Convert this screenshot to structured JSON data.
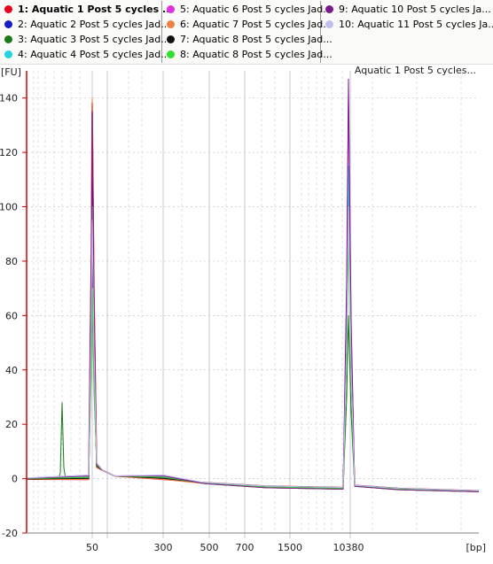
{
  "legend": {
    "items": [
      {
        "label": "1: Aquatic 1 Post 5 cycles ...",
        "color": "#e8001c",
        "selected": true
      },
      {
        "label": "2: Aquatic 2 Post 5 cycles Jad...",
        "color": "#1a1ac8"
      },
      {
        "label": "3: Aquatic 3 Post 5 cycles Jad...",
        "color": "#1a7a1a"
      },
      {
        "label": "4: Aquatic 4 Post 5 cycles Jad...",
        "color": "#22d4e0"
      },
      {
        "label": "5: Aquatic 6 Post 5 cycles Jad...",
        "color": "#e030e0"
      },
      {
        "label": "6: Aquatic 7 Post 5 cycles Jad...",
        "color": "#f08040"
      },
      {
        "label": "7: Aquatic 8 Post 5 cycles Jad...",
        "color": "#111111"
      },
      {
        "label": "8: Aquatic 8 Post 5 cycles Jad...",
        "color": "#30e030"
      },
      {
        "label": "9: Aquatic 10 Post 5 cycles Ja...",
        "color": "#7a1a8a"
      },
      {
        "label": "10: Aquatic 11 Post 5 cycles Ja...",
        "color": "#c0c0f0"
      }
    ]
  },
  "chart_data": {
    "type": "line",
    "title": "Aquatic 1 Post 5 cycles...",
    "ylabel": "[FU]",
    "xlabel": "[bp]",
    "ylim": [
      -20,
      150
    ],
    "yticks": [
      -20,
      0,
      20,
      40,
      60,
      80,
      100,
      120,
      140
    ],
    "xtick_labels": [
      "50",
      "300",
      "500",
      "700",
      "1500",
      "10380"
    ],
    "grid": true,
    "series": [
      {
        "name": "1: Aquatic 1 Post 5 cycles ...",
        "color": "#e8001c",
        "peak_lower": 138,
        "peak_upper": 104
      },
      {
        "name": "2: Aquatic 2 Post 5 cycles Jad...",
        "color": "#1a1ac8",
        "peak_lower": 110,
        "peak_upper": 100
      },
      {
        "name": "3: Aquatic 3 Post 5 cycles Jad...",
        "color": "#1a7a1a",
        "peak_lower": 100,
        "peak_upper": 60,
        "extra_peak": 28
      },
      {
        "name": "4: Aquatic 4 Post 5 cycles Jad...",
        "color": "#22d4e0",
        "peak_lower": 100,
        "peak_upper": 115
      },
      {
        "name": "5: Aquatic 6 Post 5 cycles Jad...",
        "color": "#e030e0",
        "peak_lower": 65,
        "peak_upper": 140
      },
      {
        "name": "6: Aquatic 7 Post 5 cycles Jad...",
        "color": "#f08040",
        "peak_lower": 140,
        "peak_upper": 100
      },
      {
        "name": "7: Aquatic 8 Post 5 cycles Jad...",
        "color": "#111111",
        "peak_lower": 80,
        "peak_upper": 95
      },
      {
        "name": "8: Aquatic 8 Post 5 cycles Jad...",
        "color": "#30e030",
        "peak_lower": 70,
        "peak_upper": 90
      },
      {
        "name": "9: Aquatic 10 Post 5 cycles Ja...",
        "color": "#7a1a8a",
        "peak_lower": 135,
        "peak_upper": 147
      },
      {
        "name": "10: Aquatic 11 Post 5 cycles Ja...",
        "color": "#c0c0f0",
        "peak_lower": 95,
        "peak_upper": 100
      }
    ]
  }
}
